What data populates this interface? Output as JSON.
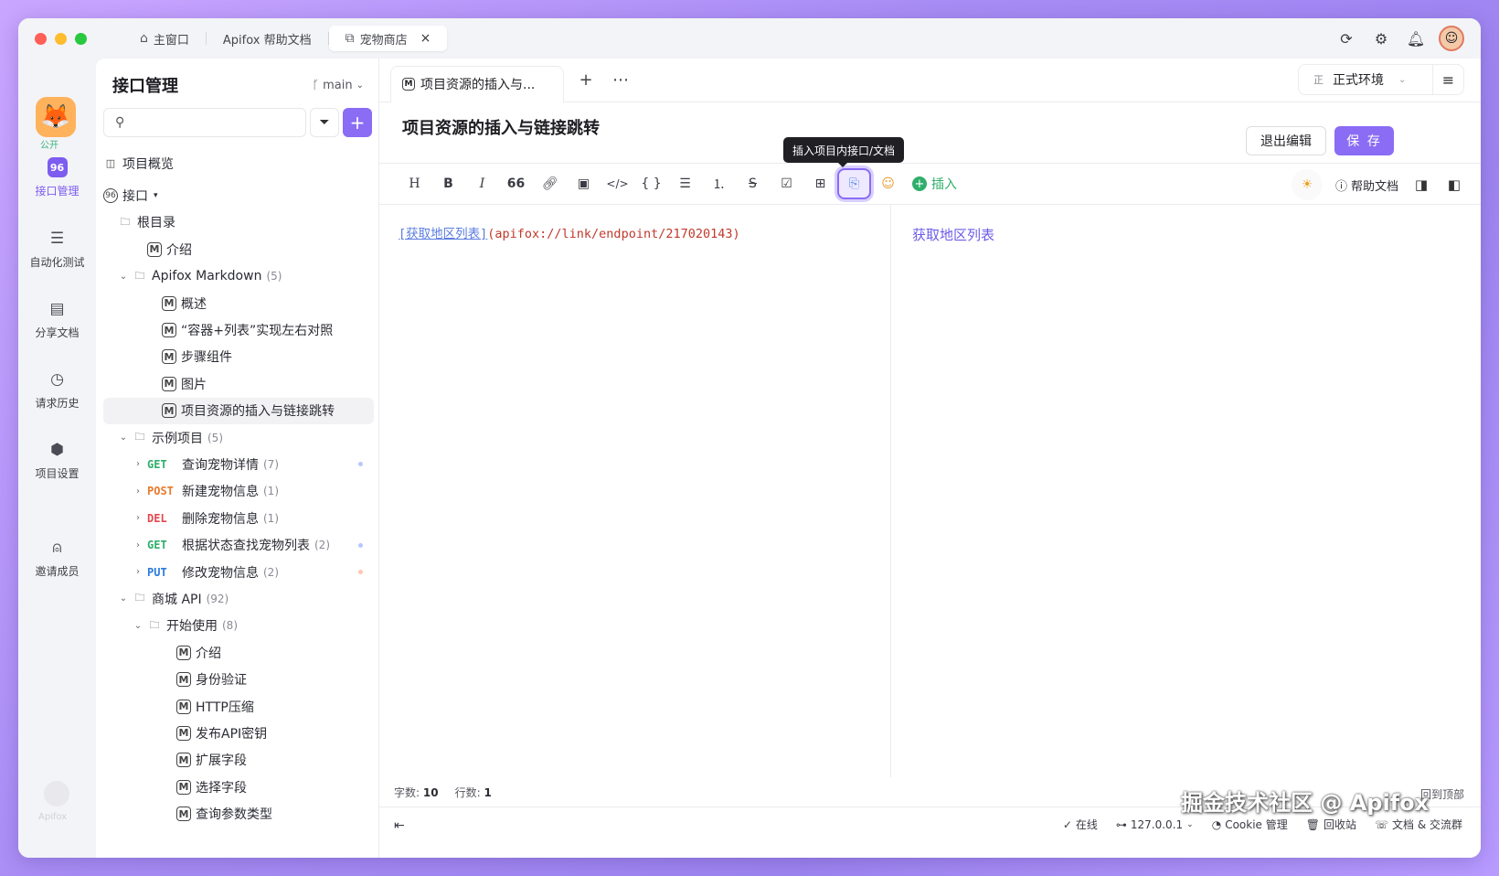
{
  "window_tabs": [
    {
      "label": "主窗口",
      "icon": "home-icon"
    },
    {
      "label": "Apifox 帮助文档",
      "icon": ""
    },
    {
      "label": "宠物商店",
      "icon": "external-link-icon"
    }
  ],
  "rail": {
    "project_badge": "公开",
    "items": [
      {
        "label": "接口管理",
        "icon": "api-icon"
      },
      {
        "label": "自动化测试",
        "icon": "stack-icon"
      },
      {
        "label": "分享文档",
        "icon": "book-icon"
      },
      {
        "label": "请求历史",
        "icon": "clock-icon"
      },
      {
        "label": "项目设置",
        "icon": "settings-hex-icon"
      },
      {
        "label": "邀请成员",
        "icon": "user-plus-icon"
      }
    ],
    "footer_text": "Apifox"
  },
  "tree": {
    "title": "接口管理",
    "branch": "main",
    "search_placeholder": "",
    "overview": "项目概览",
    "api_root": "接口",
    "root_dir": "根目录",
    "nodes": [
      {
        "level": 1,
        "type": "doc",
        "label": "介绍"
      },
      {
        "level": 0,
        "type": "folder",
        "label": "Apifox Markdown",
        "count": "(5)",
        "open": true
      },
      {
        "level": 2,
        "type": "doc",
        "label": "概述"
      },
      {
        "level": 2,
        "type": "doc",
        "label": "“容器+列表”实现左右对照"
      },
      {
        "level": 2,
        "type": "doc",
        "label": "步骤组件"
      },
      {
        "level": 2,
        "type": "doc",
        "label": "图片"
      },
      {
        "level": 2,
        "type": "doc",
        "label": "项目资源的插入与链接跳转",
        "selected": true
      },
      {
        "level": 0,
        "type": "folder",
        "label": "示例项目",
        "count": "(5)",
        "open": true
      },
      {
        "level": 1,
        "type": "api",
        "method": "GET",
        "label": "查询宠物详情",
        "count": "(7)",
        "dot": "#b6c8ff"
      },
      {
        "level": 1,
        "type": "api",
        "method": "POST",
        "label": "新建宠物信息",
        "count": "(1)"
      },
      {
        "level": 1,
        "type": "api",
        "method": "DEL",
        "label": "删除宠物信息",
        "count": "(1)"
      },
      {
        "level": 1,
        "type": "api",
        "method": "GET",
        "label": "根据状态查找宠物列表",
        "count": "(2)",
        "dot": "#b6c8ff"
      },
      {
        "level": 1,
        "type": "api",
        "method": "PUT",
        "label": "修改宠物信息",
        "count": "(2)",
        "dot": "#ffc7b0"
      },
      {
        "level": 0,
        "type": "folder",
        "label": "商城 API",
        "count": "(92)",
        "open": true
      },
      {
        "level": 1,
        "type": "folder",
        "label": "开始使用",
        "count": "(8)",
        "open": true
      },
      {
        "level": 3,
        "type": "doc",
        "label": "介绍"
      },
      {
        "level": 3,
        "type": "doc",
        "label": "身份验证"
      },
      {
        "level": 3,
        "type": "doc",
        "label": "HTTP压缩"
      },
      {
        "level": 3,
        "type": "doc",
        "label": "发布API密钥"
      },
      {
        "level": 3,
        "type": "doc",
        "label": "扩展字段"
      },
      {
        "level": 3,
        "type": "doc",
        "label": "选择字段"
      },
      {
        "level": 3,
        "type": "doc",
        "label": "查询参数类型"
      }
    ]
  },
  "doc": {
    "tab_label": "项目资源的插入与...",
    "title": "项目资源的插入与链接跳转",
    "environment": "正式环境",
    "env_badge": "正",
    "exit_label": "退出编辑",
    "save_label": "保 存",
    "tooltip": "插入项目内接口/文档",
    "insert_label": "插入",
    "help_label": "帮助文档",
    "editor_link_text": "[获取地区列表]",
    "editor_link_url": "(apifox://link/endpoint/217020143)",
    "preview_link": "获取地区列表"
  },
  "status": {
    "chars_label": "字数:",
    "chars": "10",
    "lines_label": "行数:",
    "lines": "1",
    "back_top": "回到顶部"
  },
  "footer": {
    "online": "在线",
    "host": "127.0.0.1",
    "cookie": "Cookie 管理",
    "recycle": "回收站",
    "community": "文档 & 交流群"
  },
  "watermark": "掘金技术社区 @ Apifox"
}
